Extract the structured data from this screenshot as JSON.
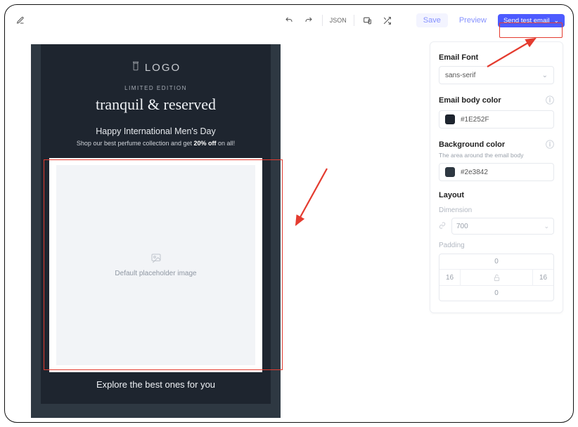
{
  "toolbar": {
    "json_label": "JSON",
    "save_label": "Save",
    "preview_label": "Preview",
    "send_test_label": "Send test email"
  },
  "email": {
    "logo_text": "LOGO",
    "pill": "LIMITED EDITION",
    "title": "tranquil & reserved",
    "subhead": "Happy International Men's Day",
    "subline_prefix": "Shop our best perfume collection and get ",
    "subline_bold": "20% off",
    "subline_suffix": " on all!",
    "placeholder_caption": "Default placeholder image",
    "explore": "Explore the best ones for you"
  },
  "panel": {
    "email_font_label": "Email Font",
    "email_font_value": "sans-serif",
    "body_color_label": "Email body color",
    "body_color_value": "#1E252F",
    "bg_color_label": "Background color",
    "bg_color_hint": "The area around the email body",
    "bg_color_value": "#2e3842",
    "layout_label": "Layout",
    "dimension_label": "Dimension",
    "dimension_value": "700",
    "padding_label": "Padding",
    "padding": {
      "top": "0",
      "right": "16",
      "bottom": "0",
      "left": "16"
    }
  },
  "colors": {
    "accent": "#4d5bff",
    "annotate": "#e43b2f"
  }
}
